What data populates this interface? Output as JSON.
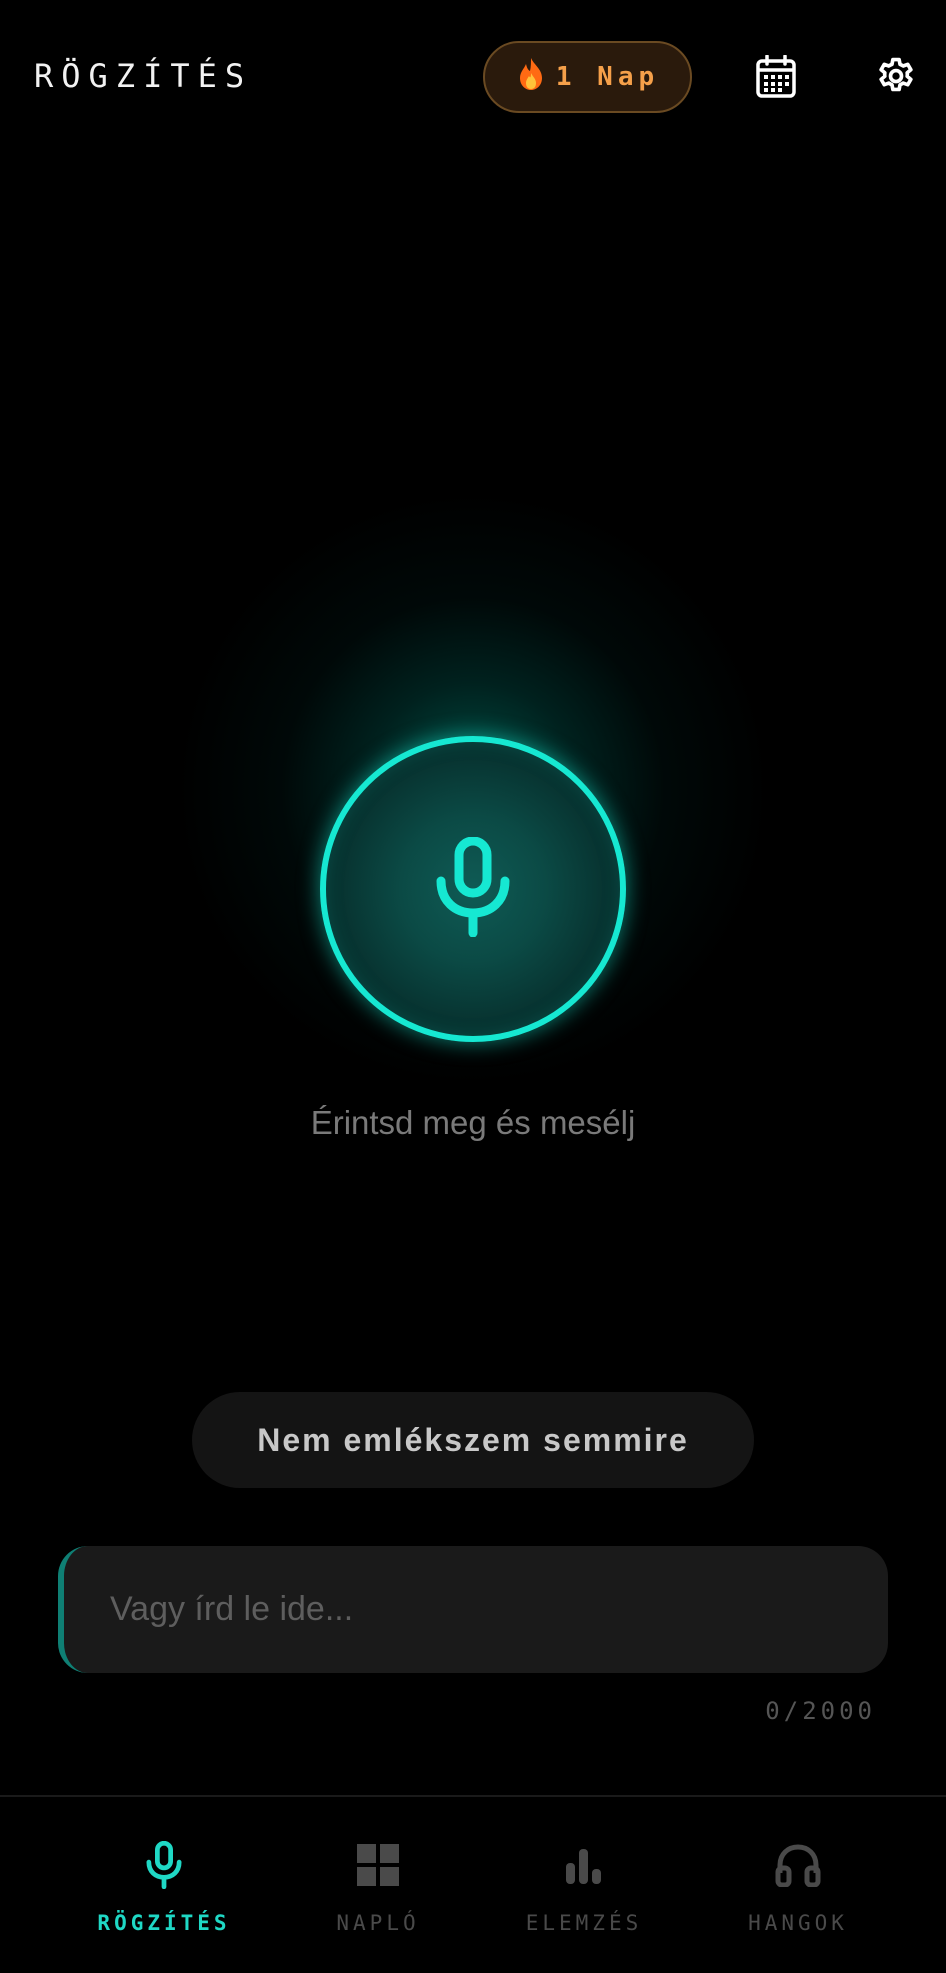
{
  "header": {
    "title": "RÖGZÍTÉS",
    "streak": {
      "icon": "fire-icon",
      "label": "1 Nap"
    },
    "actions": [
      {
        "name": "calendar-icon"
      },
      {
        "name": "gear-icon"
      }
    ]
  },
  "recorder": {
    "icon": "microphone-icon",
    "hint": "Érintsd meg és mesélj",
    "accent_color": "#16e8d2"
  },
  "forgot_button": {
    "label": "Nem emlékszem semmire"
  },
  "text_entry": {
    "placeholder": "Vagy írd le ide...",
    "value": "",
    "counter": "0/2000"
  },
  "bottom_nav": {
    "items": [
      {
        "label": "RÖGZÍTÉS",
        "icon": "microphone-icon",
        "active": true
      },
      {
        "label": "NAPLÓ",
        "icon": "grid-icon",
        "active": false
      },
      {
        "label": "ELEMZÉS",
        "icon": "bar-chart-icon",
        "active": false
      },
      {
        "label": "HANGOK",
        "icon": "headphones-icon",
        "active": false
      }
    ],
    "active_color": "#1fd8c5",
    "inactive_color": "#4a4a4a"
  }
}
